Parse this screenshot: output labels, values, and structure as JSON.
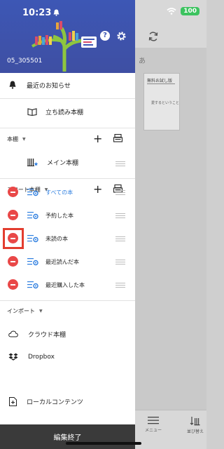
{
  "status": {
    "time": "10:23",
    "battery": "100"
  },
  "drawer": {
    "user_id": "05_305501",
    "notices": "最近のお知らせ",
    "tachiyomi": "立ち読み本棚",
    "bookshelf_section": "本棚",
    "main_shelf": "メイン本棚",
    "smart_section": "スマート本棚",
    "smart_items": [
      "すべての本",
      "予約した本",
      "未読の本",
      "最近読んだ本",
      "最近購入した本"
    ],
    "import_section": "インポート",
    "import_items": [
      "クラウド本棚",
      "Dropbox",
      "ローカルコンテンツ"
    ],
    "footer": "編集終了"
  },
  "right": {
    "header_char": "あ",
    "book_title": "無料お試し版",
    "book_subtitle": "愛するということ",
    "bottom_items": [
      "メニュー",
      "並び替え"
    ]
  },
  "colors": {
    "header": "#3d57b5",
    "accent": "#2f7fe0",
    "minus": "#e94848",
    "highlight": "#e33d2f"
  }
}
